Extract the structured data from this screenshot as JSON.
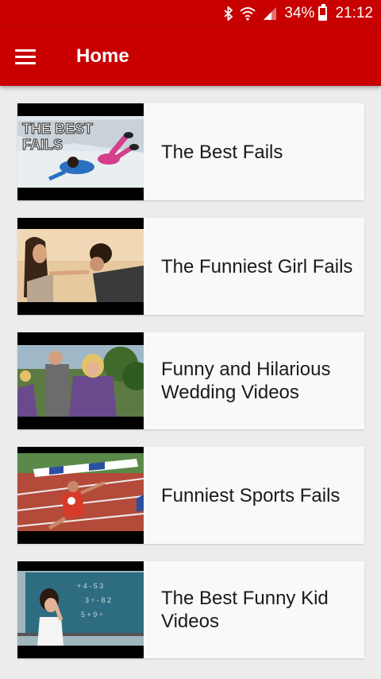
{
  "status_bar": {
    "battery": "34%",
    "battery_level": 0.34,
    "time": "21:12",
    "icons": [
      "bluetooth-icon",
      "wifi-icon",
      "signal-icon",
      "battery-icon"
    ]
  },
  "app_bar": {
    "title": "Home",
    "menu_icon": "hamburger-menu-icon",
    "color": "#c80000"
  },
  "videos": [
    {
      "title": "The Best Fails",
      "thumb_text": "THE BEST FAILS"
    },
    {
      "title": "The Funniest Girl Fails"
    },
    {
      "title": "Funny and Hilarious Wedding Videos"
    },
    {
      "title": "Funniest Sports Fails"
    },
    {
      "title": "The Best Funny Kid Videos"
    }
  ]
}
